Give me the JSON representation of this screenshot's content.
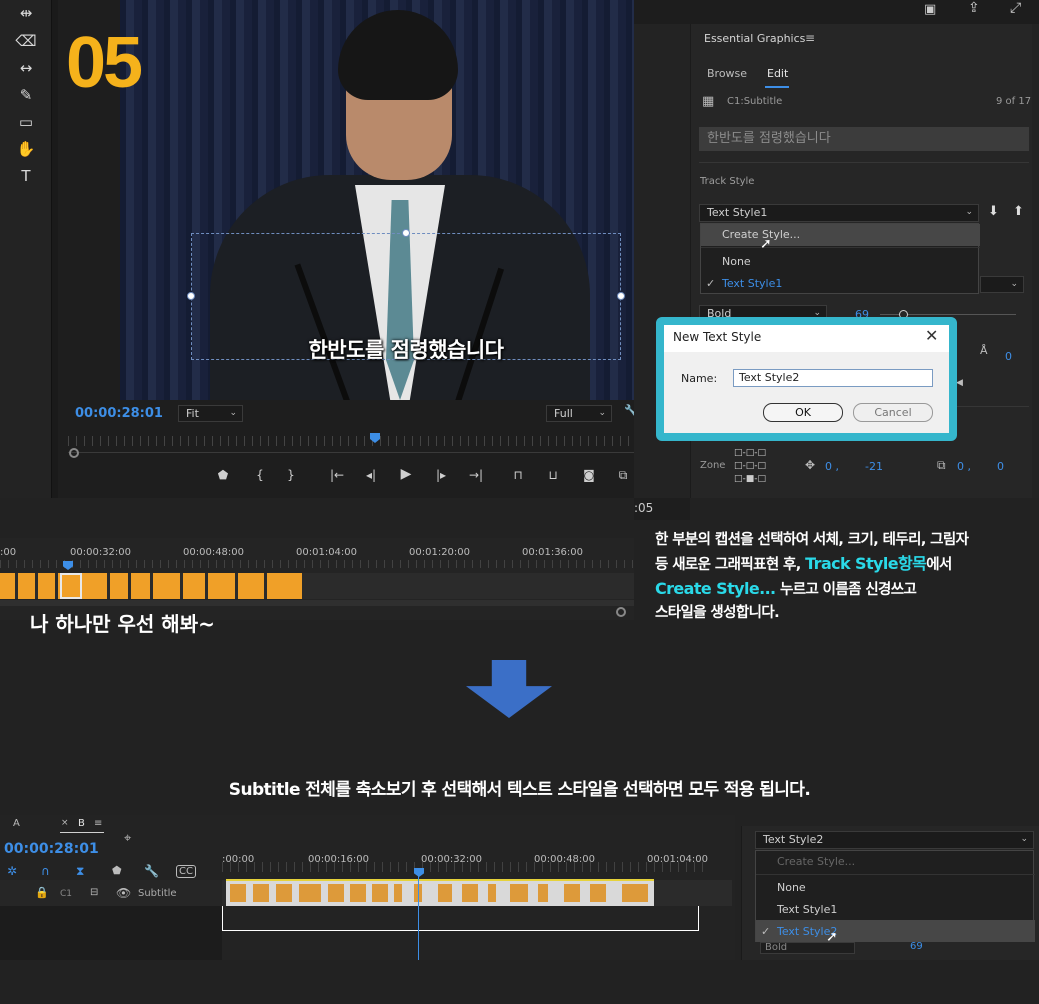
{
  "step_number": "05",
  "program_monitor": {
    "timecode": "00:00:28:01",
    "zoom": "Fit",
    "resolution": "Full",
    "caption_text": "한반도를 점령했습니다"
  },
  "essential_graphics": {
    "panel_title": "Essential Graphics",
    "tabs": [
      "Browse",
      "Edit"
    ],
    "active_tab": "Edit",
    "layer_name": "C1:Subtitle",
    "layer_count": "9 of 17",
    "text_value": "한반도를 점령했습니다",
    "track_style_label": "Track Style",
    "track_style_value": "Text Style1",
    "menu": [
      "Create Style...",
      "None",
      "Text Style1"
    ],
    "checked_item": "Text Style1",
    "font_weight": "Bold",
    "font_size": "69",
    "tracking": "0",
    "zone_label": "Zone",
    "pos_x": "0 ,",
    "pos_y": "-21",
    "anchor_x": "0 ,",
    "anchor_y": "0"
  },
  "new_text_style_dialog": {
    "title": "New Text Style",
    "name_label": "Name:",
    "name_value": "Text Style2",
    "ok_label": "OK",
    "cancel_label": "Cancel"
  },
  "middle_timeline": {
    "ticks": [
      ":00",
      "00:00:32:00",
      "00:00:48:00",
      "00:01:04:00",
      "00:01:20:00",
      "00:01:36:00"
    ],
    "edge_label": ":05",
    "handwritten_note": "나 하나만 우선 해봐~"
  },
  "description": {
    "line1": "한 부분의 캡션을 선택하여 서체, 크기, 테두리, 그림자",
    "line2_pre": "등 새로운 그래픽표현 후, ",
    "line2_highlight": "Track Style항목",
    "line2_post": "에서",
    "line3_highlight": "Create Style...",
    "line3_post": " 누르고 이름좀 신경쓰고",
    "line4": "스타일을 생성합니다."
  },
  "bottom_caption": "Subtitle 전체를 축소보기 후 선택해서 텍스트 스타일을 선택하면 모두 적용 됩니다.",
  "bottom_timeline": {
    "tab_a": "A",
    "tab_b": "B",
    "timecode": "00:00:28:01",
    "ticks": [
      ":00:00",
      "00:00:16:00",
      "00:00:32:00",
      "00:00:48:00",
      "00:01:04:00"
    ],
    "track_id": "C1",
    "track_name": "Subtitle"
  },
  "bottom_right_menu": {
    "combo_value": "Text Style2",
    "items": [
      "Create Style...",
      "None",
      "Text Style1",
      "Text Style2"
    ],
    "checked_item": "Text Style2",
    "peek_left": "Bold",
    "peek_right": "69"
  },
  "colors": {
    "accent_blue": "#3d8ee6",
    "step_yellow": "#f5b21b",
    "highlight_cyan": "#2ad9e8",
    "clip_orange": "#f0a028"
  }
}
